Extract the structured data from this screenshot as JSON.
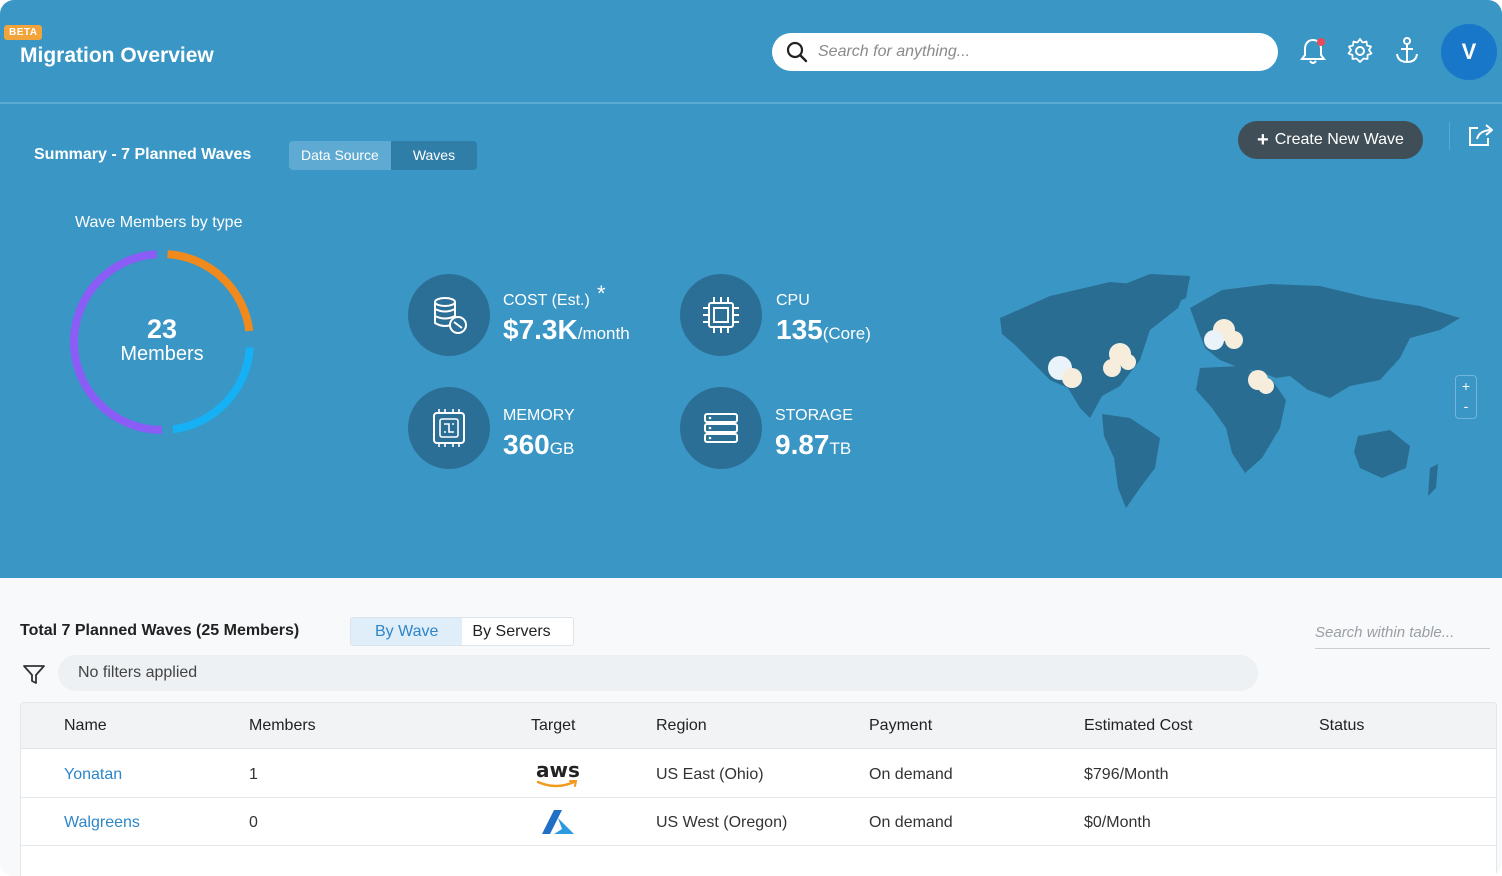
{
  "header": {
    "badge": "BETA",
    "title": "Migration Overview",
    "search_placeholder": "Search for anything...",
    "avatar_initial": "V"
  },
  "summary": {
    "title": "Summary - 7 Planned Waves",
    "segments": [
      "Data Source",
      "Waves"
    ],
    "create_button": "Create New Wave",
    "donut": {
      "title": "Wave Members by type",
      "count": "23",
      "label": "Members",
      "segment_colors": [
        "#f08a1c",
        "#16b0f5",
        "#8b5cf6"
      ]
    },
    "metrics": {
      "cost": {
        "label": "COST (Est.)",
        "asterisk": "*",
        "value": "$7.3K",
        "unit": "/month"
      },
      "cpu": {
        "label": "CPU",
        "value": "135",
        "unit": "(Core)"
      },
      "memory": {
        "label": "MEMORY",
        "value": "360",
        "unit": "GB"
      },
      "storage": {
        "label": "STORAGE",
        "value": "9.87",
        "unit": "TB"
      }
    },
    "map": {
      "zoom_in": "+",
      "zoom_out": "-"
    }
  },
  "table_section": {
    "title": "Total 7 Planned Waves (25 Members)",
    "views": [
      "By Wave",
      "By Servers"
    ],
    "search_placeholder": "Search within table...",
    "filter_text": "No filters applied",
    "columns": [
      "Name",
      "Members",
      "Target",
      "Region",
      "Payment",
      "Estimated Cost",
      "Status"
    ],
    "rows": [
      {
        "name": "Yonatan",
        "members": "1",
        "target_icon": "aws-logo",
        "target_text": "aws",
        "region": "US East (Ohio)",
        "payment": "On demand",
        "cost": "$796/Month",
        "status": ""
      },
      {
        "name": "Walgreens",
        "members": "0",
        "target_icon": "azure-logo",
        "region": "US West (Oregon)",
        "payment": "On demand",
        "cost": "$0/Month",
        "status": ""
      }
    ]
  }
}
